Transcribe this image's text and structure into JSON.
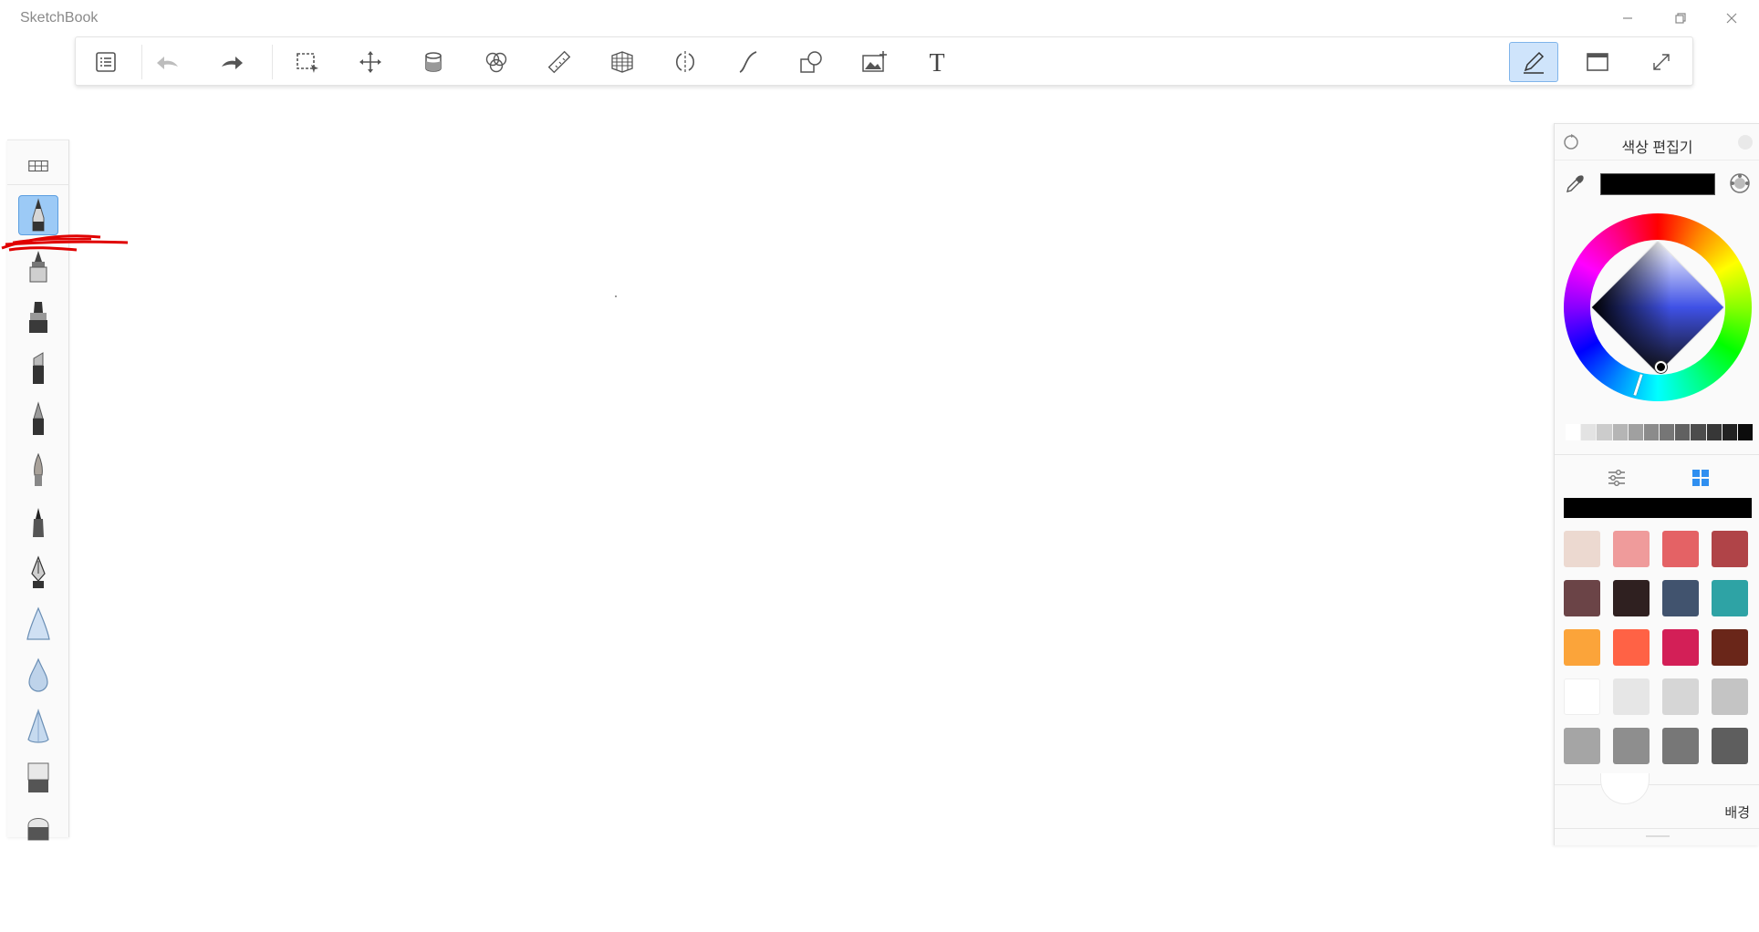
{
  "window": {
    "title": "SketchBook"
  },
  "toolbar": {
    "icons": [
      "list-icon",
      "undo-icon",
      "redo-icon",
      "selection-icon",
      "move-icon",
      "fill-icon",
      "blend-icon",
      "ruler-icon",
      "perspective-icon",
      "symmetry-icon",
      "curve-icon",
      "shapes-icon",
      "image-icon",
      "text-icon",
      "pen-mode-icon",
      "window-icon",
      "fullscreen-icon"
    ],
    "text_label": "T"
  },
  "brushes": [
    "pencil",
    "ink-pen",
    "marker",
    "chisel-marker",
    "ballpoint",
    "paintbrush",
    "felt-tip",
    "fountain-pen",
    "airbrush",
    "water-drop",
    "cone-brush",
    "flat-eraser",
    "round-eraser"
  ],
  "color_panel": {
    "title": "색상 편집기",
    "current_color": "#000000",
    "background_label": "배경",
    "grays": [
      "#ffffff",
      "#e3e3e3",
      "#cccccc",
      "#b5b5b5",
      "#a0a0a0",
      "#8b8b8b",
      "#767676",
      "#616161",
      "#4c4c4c",
      "#373737",
      "#222222",
      "#0c0c0c"
    ],
    "swatches": [
      "#ecd9d0",
      "#ef9b9b",
      "#e46265",
      "#b04448",
      "#6b4447",
      "#2f2020",
      "#41536e",
      "#2ea3a5",
      "#fba43a",
      "#ff6245",
      "#d31f57",
      "#6a2619",
      "#ffffff",
      "#e6e6e6",
      "#d6d6d6",
      "#c4c4c4",
      "#a5a5a5",
      "#8e8e8e",
      "#777777",
      "#5e5e5e"
    ]
  },
  "colors": {
    "accent": "#5c9ee0",
    "annotation": "#e00000"
  }
}
